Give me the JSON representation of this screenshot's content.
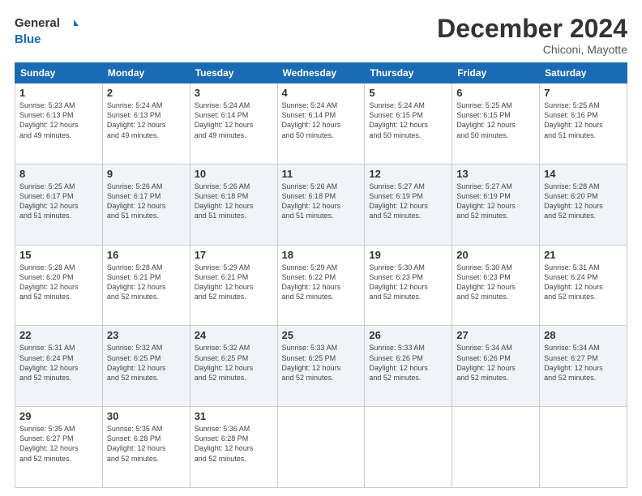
{
  "logo": {
    "line1": "General",
    "line2": "Blue"
  },
  "title": "December 2024",
  "location": "Chiconi, Mayotte",
  "days_of_week": [
    "Sunday",
    "Monday",
    "Tuesday",
    "Wednesday",
    "Thursday",
    "Friday",
    "Saturday"
  ],
  "weeks": [
    [
      {
        "day": "1",
        "info": "Sunrise: 5:23 AM\nSunset: 6:13 PM\nDaylight: 12 hours\nand 49 minutes."
      },
      {
        "day": "2",
        "info": "Sunrise: 5:24 AM\nSunset: 6:13 PM\nDaylight: 12 hours\nand 49 minutes."
      },
      {
        "day": "3",
        "info": "Sunrise: 5:24 AM\nSunset: 6:14 PM\nDaylight: 12 hours\nand 49 minutes."
      },
      {
        "day": "4",
        "info": "Sunrise: 5:24 AM\nSunset: 6:14 PM\nDaylight: 12 hours\nand 50 minutes."
      },
      {
        "day": "5",
        "info": "Sunrise: 5:24 AM\nSunset: 6:15 PM\nDaylight: 12 hours\nand 50 minutes."
      },
      {
        "day": "6",
        "info": "Sunrise: 5:25 AM\nSunset: 6:15 PM\nDaylight: 12 hours\nand 50 minutes."
      },
      {
        "day": "7",
        "info": "Sunrise: 5:25 AM\nSunset: 6:16 PM\nDaylight: 12 hours\nand 51 minutes."
      }
    ],
    [
      {
        "day": "8",
        "info": "Sunrise: 5:25 AM\nSunset: 6:17 PM\nDaylight: 12 hours\nand 51 minutes."
      },
      {
        "day": "9",
        "info": "Sunrise: 5:26 AM\nSunset: 6:17 PM\nDaylight: 12 hours\nand 51 minutes."
      },
      {
        "day": "10",
        "info": "Sunrise: 5:26 AM\nSunset: 6:18 PM\nDaylight: 12 hours\nand 51 minutes."
      },
      {
        "day": "11",
        "info": "Sunrise: 5:26 AM\nSunset: 6:18 PM\nDaylight: 12 hours\nand 51 minutes."
      },
      {
        "day": "12",
        "info": "Sunrise: 5:27 AM\nSunset: 6:19 PM\nDaylight: 12 hours\nand 52 minutes."
      },
      {
        "day": "13",
        "info": "Sunrise: 5:27 AM\nSunset: 6:19 PM\nDaylight: 12 hours\nand 52 minutes."
      },
      {
        "day": "14",
        "info": "Sunrise: 5:28 AM\nSunset: 6:20 PM\nDaylight: 12 hours\nand 52 minutes."
      }
    ],
    [
      {
        "day": "15",
        "info": "Sunrise: 5:28 AM\nSunset: 6:20 PM\nDaylight: 12 hours\nand 52 minutes."
      },
      {
        "day": "16",
        "info": "Sunrise: 5:28 AM\nSunset: 6:21 PM\nDaylight: 12 hours\nand 52 minutes."
      },
      {
        "day": "17",
        "info": "Sunrise: 5:29 AM\nSunset: 6:21 PM\nDaylight: 12 hours\nand 52 minutes."
      },
      {
        "day": "18",
        "info": "Sunrise: 5:29 AM\nSunset: 6:22 PM\nDaylight: 12 hours\nand 52 minutes."
      },
      {
        "day": "19",
        "info": "Sunrise: 5:30 AM\nSunset: 6:23 PM\nDaylight: 12 hours\nand 52 minutes."
      },
      {
        "day": "20",
        "info": "Sunrise: 5:30 AM\nSunset: 6:23 PM\nDaylight: 12 hours\nand 52 minutes."
      },
      {
        "day": "21",
        "info": "Sunrise: 5:31 AM\nSunset: 6:24 PM\nDaylight: 12 hours\nand 52 minutes."
      }
    ],
    [
      {
        "day": "22",
        "info": "Sunrise: 5:31 AM\nSunset: 6:24 PM\nDaylight: 12 hours\nand 52 minutes."
      },
      {
        "day": "23",
        "info": "Sunrise: 5:32 AM\nSunset: 6:25 PM\nDaylight: 12 hours\nand 52 minutes."
      },
      {
        "day": "24",
        "info": "Sunrise: 5:32 AM\nSunset: 6:25 PM\nDaylight: 12 hours\nand 52 minutes."
      },
      {
        "day": "25",
        "info": "Sunrise: 5:33 AM\nSunset: 6:25 PM\nDaylight: 12 hours\nand 52 minutes."
      },
      {
        "day": "26",
        "info": "Sunrise: 5:33 AM\nSunset: 6:26 PM\nDaylight: 12 hours\nand 52 minutes."
      },
      {
        "day": "27",
        "info": "Sunrise: 5:34 AM\nSunset: 6:26 PM\nDaylight: 12 hours\nand 52 minutes."
      },
      {
        "day": "28",
        "info": "Sunrise: 5:34 AM\nSunset: 6:27 PM\nDaylight: 12 hours\nand 52 minutes."
      }
    ],
    [
      {
        "day": "29",
        "info": "Sunrise: 5:35 AM\nSunset: 6:27 PM\nDaylight: 12 hours\nand 52 minutes."
      },
      {
        "day": "30",
        "info": "Sunrise: 5:35 AM\nSunset: 6:28 PM\nDaylight: 12 hours\nand 52 minutes."
      },
      {
        "day": "31",
        "info": "Sunrise: 5:36 AM\nSunset: 6:28 PM\nDaylight: 12 hours\nand 52 minutes."
      },
      null,
      null,
      null,
      null
    ]
  ]
}
